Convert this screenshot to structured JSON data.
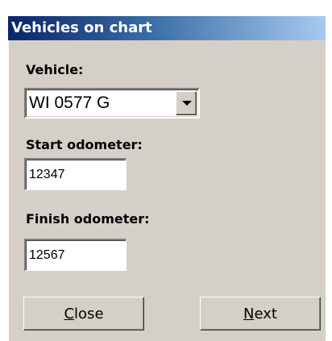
{
  "dialog": {
    "title": "Vehicles on chart"
  },
  "vehicle": {
    "label": "Vehicle:",
    "selected": "WI 0577 G"
  },
  "start_odometer": {
    "label": "Start odometer:",
    "value": "12347"
  },
  "finish_odometer": {
    "label": "Finish odometer:",
    "value": "12567"
  },
  "buttons": {
    "close_mnemonic": "C",
    "close_rest": "lose",
    "next_mnemonic": "N",
    "next_rest": "ext"
  },
  "icons": {
    "combo_arrow": "chevron-down-icon"
  },
  "colors": {
    "title_gradient_start": "#0a246a",
    "title_gradient_end": "#a6caf0",
    "face": "#d4d0c8"
  }
}
